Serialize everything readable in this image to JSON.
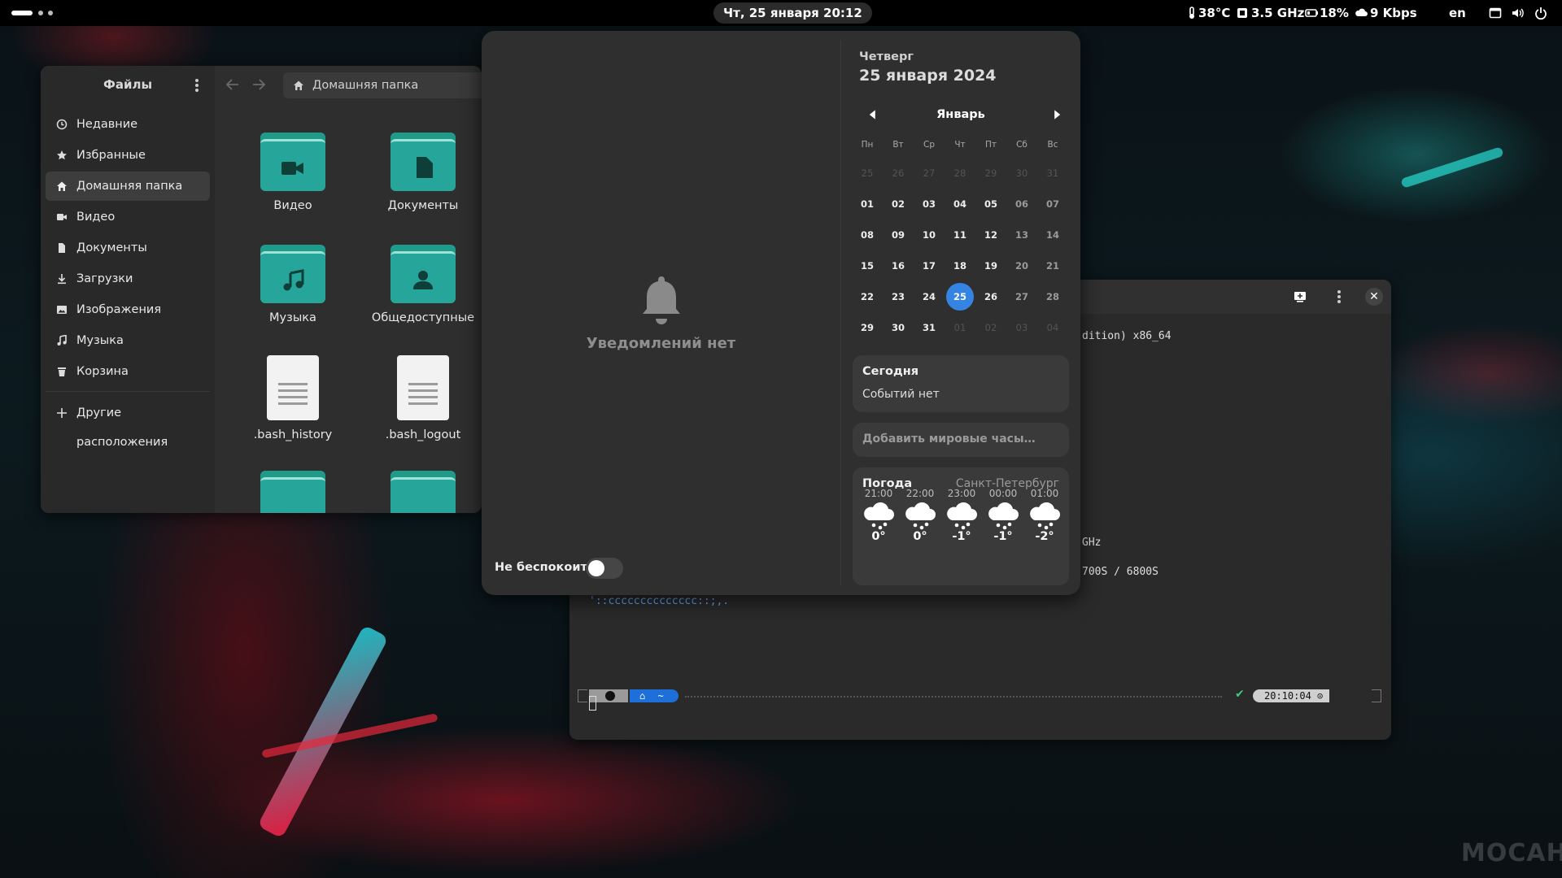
{
  "topbar": {
    "datetime": "Чт, 25 января  20:12",
    "temperature": "38°C",
    "cpu_freq": "3.5 GHz",
    "battery": "18%",
    "network": "9 Kbps",
    "keyboard_layout": "en"
  },
  "files": {
    "title": "Файлы",
    "path": "Домашняя папка",
    "sidebar": [
      {
        "label": "Недавние",
        "icon": "clock-icon"
      },
      {
        "label": "Избранные",
        "icon": "star-icon"
      },
      {
        "label": "Домашняя папка",
        "icon": "home-icon",
        "active": true
      },
      {
        "label": "Видео",
        "icon": "video-icon"
      },
      {
        "label": "Документы",
        "icon": "document-icon"
      },
      {
        "label": "Загрузки",
        "icon": "download-icon"
      },
      {
        "label": "Изображения",
        "icon": "image-icon"
      },
      {
        "label": "Музыка",
        "icon": "music-icon"
      },
      {
        "label": "Корзина",
        "icon": "trash-icon"
      }
    ],
    "other_locations": "Другие расположения",
    "items": [
      {
        "name": "Видео",
        "type": "folder",
        "icon": "video-icon"
      },
      {
        "name": "Документы",
        "type": "folder",
        "icon": "document-icon"
      },
      {
        "name": "Музыка",
        "type": "folder",
        "icon": "music-icon"
      },
      {
        "name": "Общедоступные",
        "type": "folder",
        "icon": "user-icon"
      },
      {
        "name": ".bash_history",
        "type": "file"
      },
      {
        "name": ".bash_logout",
        "type": "file"
      }
    ]
  },
  "notifications": {
    "empty_text": "Уведомлений нет",
    "dnd_label": "Не беспокоить",
    "dnd_enabled": false
  },
  "calendar": {
    "weekday": "Четверг",
    "full_date": "25 января 2024",
    "month": "Январь",
    "day_names": [
      "Пн",
      "Вт",
      "Ср",
      "Чт",
      "Пт",
      "Сб",
      "Вс"
    ],
    "weeks": [
      [
        "25",
        "26",
        "27",
        "28",
        "29",
        "30",
        "31"
      ],
      [
        "01",
        "02",
        "03",
        "04",
        "05",
        "06",
        "07"
      ],
      [
        "08",
        "09",
        "10",
        "11",
        "12",
        "13",
        "14"
      ],
      [
        "15",
        "16",
        "17",
        "18",
        "19",
        "20",
        "21"
      ],
      [
        "22",
        "23",
        "24",
        "25",
        "26",
        "27",
        "28"
      ],
      [
        "29",
        "30",
        "31",
        "01",
        "02",
        "03",
        "04"
      ]
    ],
    "today": "25",
    "events_title": "Сегодня",
    "events_text": "Событий нет",
    "world_clocks": "Добавить мировые часы…"
  },
  "weather": {
    "title": "Погода",
    "location": "Санкт-Петербург",
    "forecast": [
      {
        "time": "21:00",
        "temp": "0°",
        "icon": "cloud-snow-icon"
      },
      {
        "time": "22:00",
        "temp": "0°",
        "icon": "cloud-snow-icon"
      },
      {
        "time": "23:00",
        "temp": "-1°",
        "icon": "cloud-snow-icon"
      },
      {
        "time": "00:00",
        "temp": "-1°",
        "icon": "cloud-snow-icon"
      },
      {
        "time": "01:00",
        "temp": "-2°",
        "icon": "cloud-snow-icon"
      }
    ]
  },
  "terminal": {
    "line_arch": "dition) x86_64",
    "line_ghz": "GHz",
    "line_gpu": "700S / 6800S",
    "line_art": "'::cccccccccccccc::;,.",
    "prompt_dir": "~",
    "clock": "20:10:04"
  },
  "watermark": "MOCAH",
  "colors": {
    "accent": "#3584e4",
    "folder": "#26a69a"
  }
}
